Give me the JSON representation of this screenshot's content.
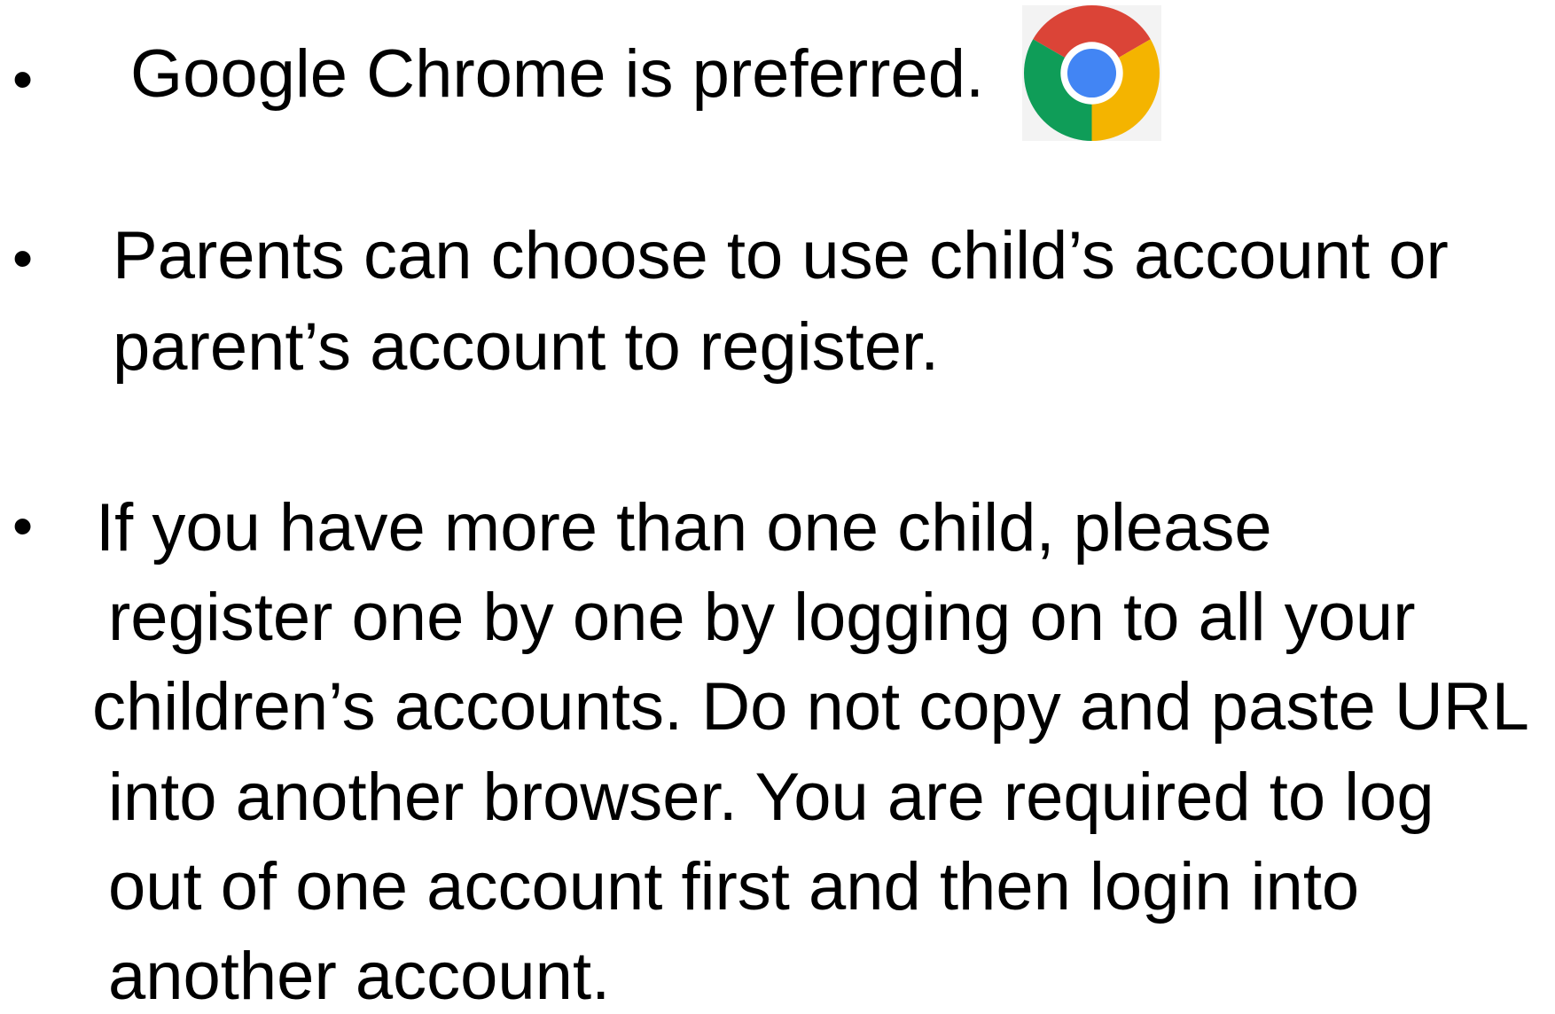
{
  "items": [
    {
      "bullet": "•",
      "lines": [
        "Google Chrome is preferred."
      ]
    },
    {
      "bullet": "•",
      "lines": [
        "Parents can choose to use child’s account or",
        "parent’s account to register."
      ]
    },
    {
      "bullet": "•",
      "lines": [
        "If you have more than one child, please",
        "register one by one by logging on to all your",
        "children’s accounts. Do not copy and paste URL",
        "into another browser. You are required to log",
        "out of one account first and then login into",
        "another account."
      ]
    }
  ],
  "icon": {
    "name": "google-chrome-icon"
  }
}
